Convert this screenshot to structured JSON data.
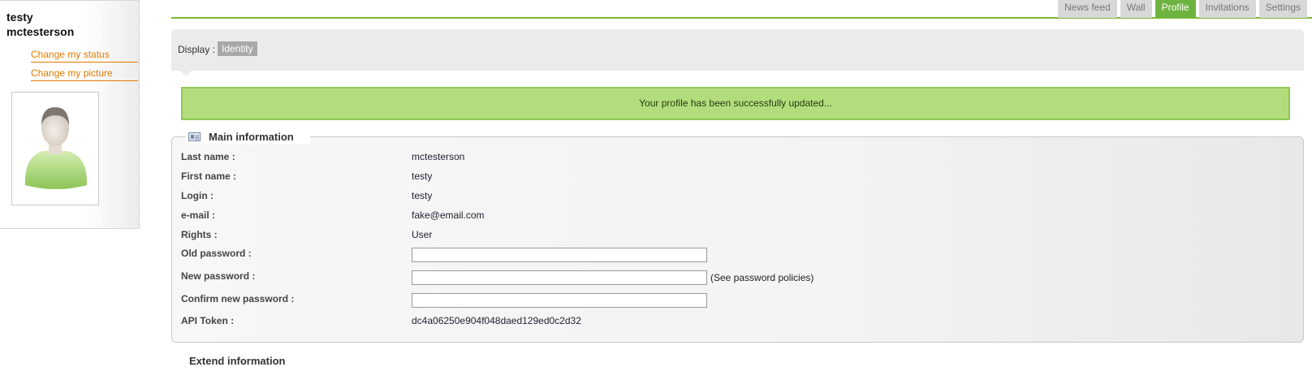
{
  "sidebar": {
    "first_name": "testy",
    "last_name": "mctesterson",
    "links": {
      "change_status": "Change my status",
      "change_picture": "Change my picture"
    },
    "avatar_icon": "user-avatar-icon"
  },
  "tabs": [
    {
      "label": "News feed",
      "active": false
    },
    {
      "label": "Wall",
      "active": false
    },
    {
      "label": "Profile",
      "active": true
    },
    {
      "label": "Invitations",
      "active": false
    },
    {
      "label": "Settings",
      "active": false
    }
  ],
  "display": {
    "label": "Display :",
    "value": "Identity"
  },
  "message": "Your profile has been successfully updated...",
  "main": {
    "title": "Main information",
    "icon": "id-card-icon",
    "fields": {
      "last_name": {
        "label": "Last name :",
        "value": "mctesterson"
      },
      "first_name": {
        "label": "First name :",
        "value": "testy"
      },
      "login": {
        "label": "Login :",
        "value": "testy"
      },
      "email": {
        "label": "e-mail :",
        "value": "fake@email.com"
      },
      "rights": {
        "label": "Rights :",
        "value": "User"
      },
      "old_password": {
        "label": "Old password :",
        "value": ""
      },
      "new_password": {
        "label": "New password :",
        "value": "",
        "hint": "(See password policies)"
      },
      "confirm_password": {
        "label": "Confirm new password :",
        "value": ""
      },
      "api_token": {
        "label": "API Token :",
        "value": "dc4a06250e904f048daed129ed0c2d32"
      }
    }
  },
  "extended": {
    "title": "Extend information"
  },
  "colors": {
    "accent_green": "#6eb33f",
    "link_orange": "#e07b00",
    "success_bg": "#b3dd7d"
  }
}
